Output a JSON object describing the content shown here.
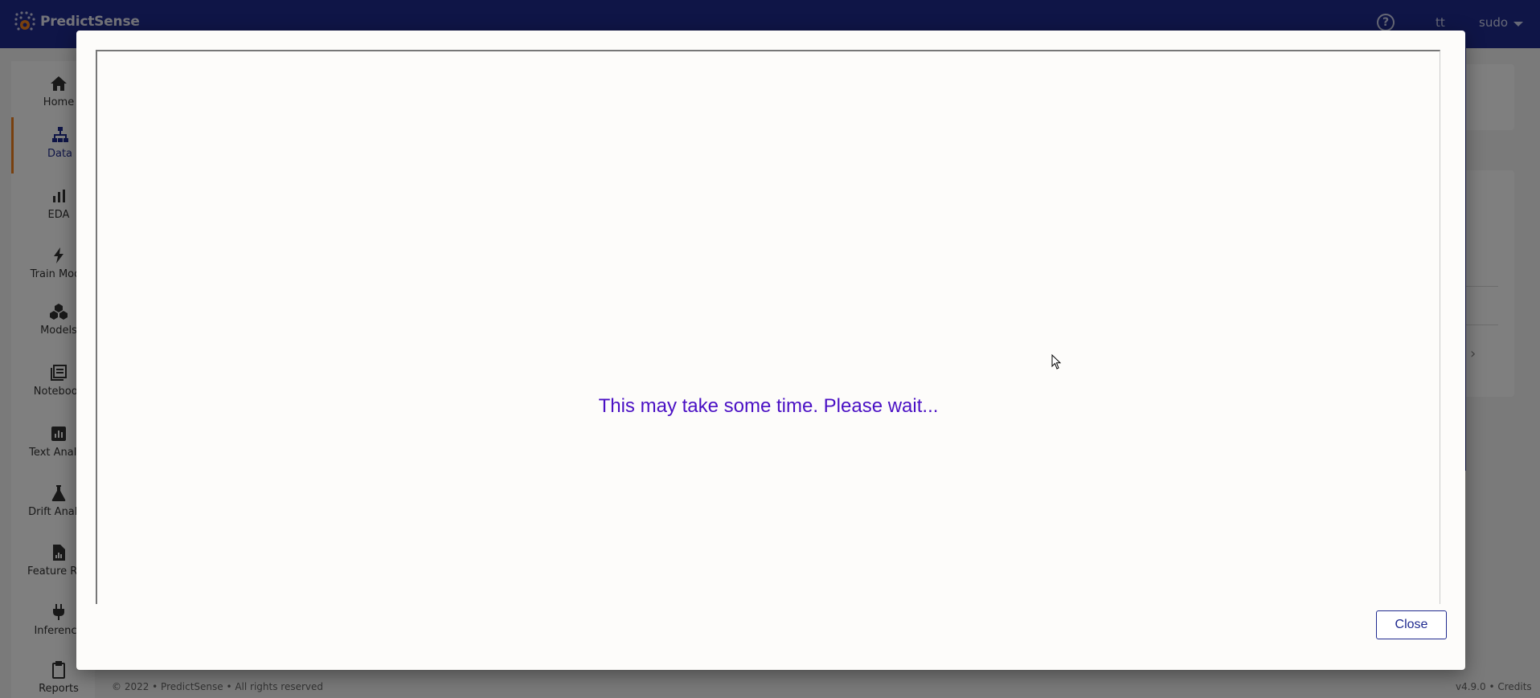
{
  "app": {
    "brand": "PredictSense",
    "help_icon": "help-circle-icon",
    "user": "tt",
    "role": "sudo"
  },
  "sidebar": {
    "items": [
      {
        "label": "Home",
        "icon": "home-icon"
      },
      {
        "label": "Data",
        "icon": "data-hierarchy-icon",
        "active": true
      },
      {
        "label": "EDA",
        "icon": "bar-chart-icon"
      },
      {
        "label": "Train Mode",
        "icon": "lightning-icon"
      },
      {
        "label": "Models",
        "icon": "cubes-icon"
      },
      {
        "label": "Notebook",
        "icon": "notebook-icon"
      },
      {
        "label": "Text Analys",
        "icon": "text-analysis-icon"
      },
      {
        "label": "Drift Analys",
        "icon": "flask-icon"
      },
      {
        "label": "Feature Rep",
        "icon": "feature-report-icon"
      },
      {
        "label": "Inference",
        "icon": "plug-icon"
      },
      {
        "label": "Reports",
        "icon": "clipboard-icon"
      }
    ]
  },
  "footer": {
    "left": "© 2022 • PredictSense • All rights reserved",
    "right": "v4.9.0 • Credits"
  },
  "modal": {
    "message": "This may take some time. Please wait...",
    "close_label": "Close"
  }
}
